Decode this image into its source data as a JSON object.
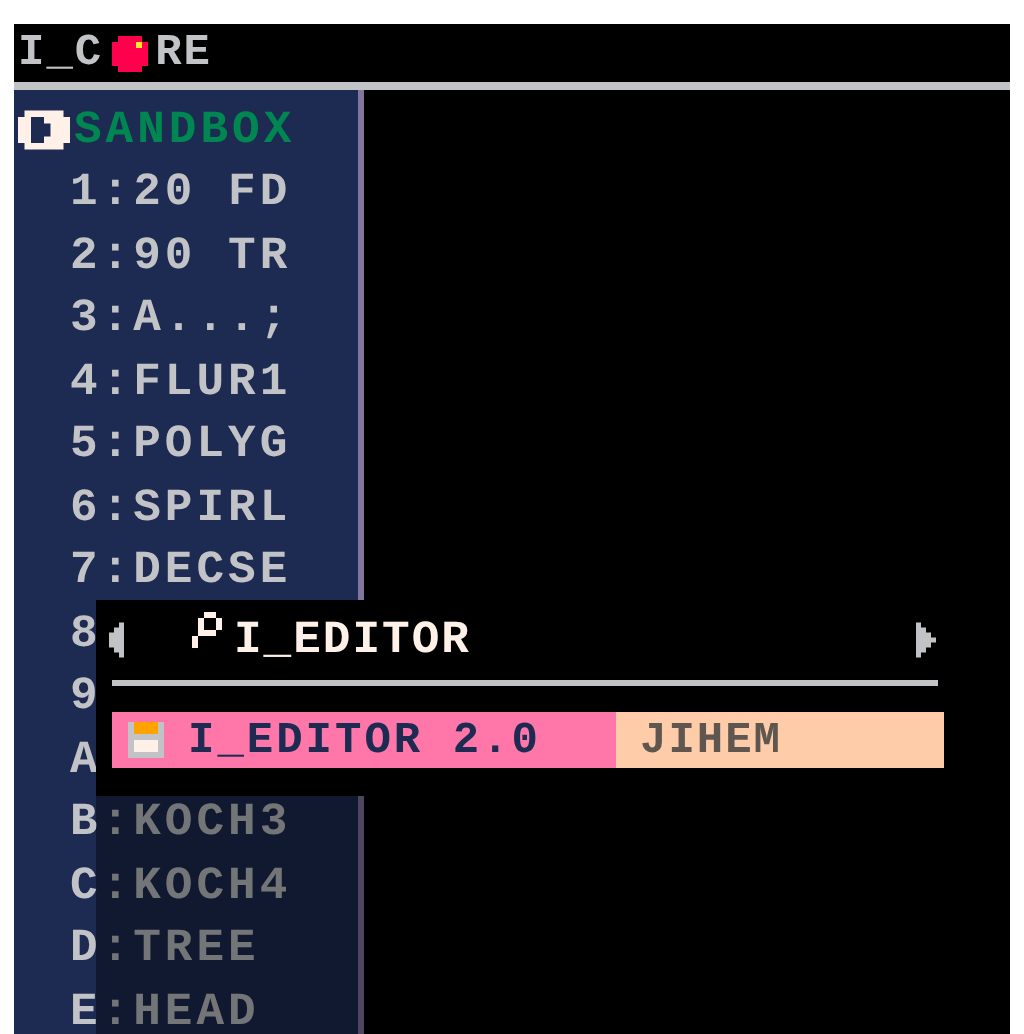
{
  "title_bar": {
    "left": "I_C",
    "right": "RE"
  },
  "sidebar": {
    "items": [
      {
        "label": "SANDBOX",
        "selected": true
      },
      {
        "label": "1:20 FD",
        "selected": false
      },
      {
        "label": "2:90 TR",
        "selected": false
      },
      {
        "label": "3:A...;",
        "selected": false
      },
      {
        "label": "4:FLUR1",
        "selected": false
      },
      {
        "label": "5:POLYG",
        "selected": false
      },
      {
        "label": "6:SPIRL",
        "selected": false
      },
      {
        "label": "7:DECSE",
        "selected": false
      },
      {
        "label": "8",
        "selected": false
      },
      {
        "label": "9",
        "selected": false
      },
      {
        "label": "A",
        "selected": false
      },
      {
        "label": "B:KOCH3",
        "selected": false
      },
      {
        "label": "C:KOCH4",
        "selected": false
      },
      {
        "label": "D:TREE",
        "selected": false
      },
      {
        "label": "E:HEAD",
        "selected": false
      }
    ]
  },
  "search_popup": {
    "query": "I_EDITOR",
    "results": [
      {
        "title": "I_EDITOR 2.0",
        "author": "JIHEM",
        "selected": true
      }
    ]
  }
}
